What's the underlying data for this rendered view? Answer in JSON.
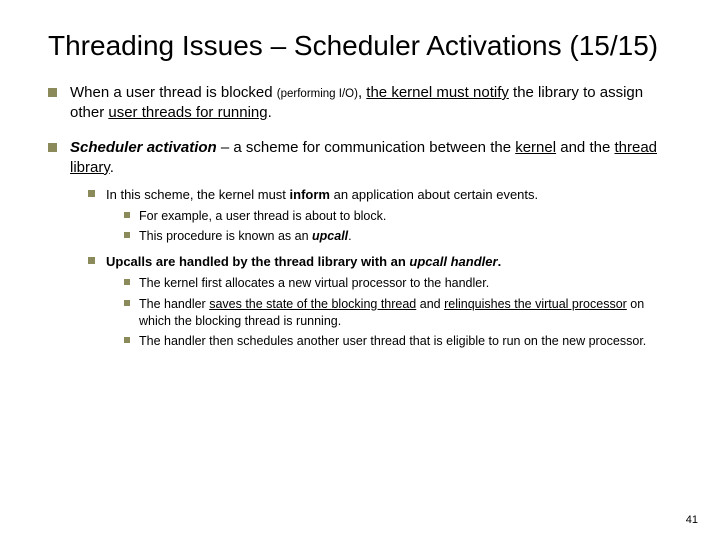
{
  "title": "Threading Issues – Scheduler Activations (15/15)",
  "bullets": {
    "b1_pre": "When a user thread is blocked ",
    "b1_small": "(performing I/O)",
    "b1_mid1": ", ",
    "b1_u1": "the kernel must notify",
    "b1_mid2": " the library to assign other ",
    "b1_u2": "user threads for running",
    "b1_end": ".",
    "b2_term": "Scheduler activation",
    "b2_mid1": " – a scheme for communication between the ",
    "b2_u1": "kernel",
    "b2_mid2": " and the ",
    "b2_u2": "thread library",
    "b2_end": ".",
    "b2a_pre": "In this scheme, the kernel must ",
    "b2a_b": "inform",
    "b2a_post": " an application about certain events.",
    "b2a_i": "For example, a user thread is about to block.",
    "b2a_ii_pre": "This procedure is known as an ",
    "b2a_ii_term": "upcall",
    "b2a_ii_end": ".",
    "b2b_pre": "Upcalls are handled by the thread library with an ",
    "b2b_term": "upcall handler",
    "b2b_end": ".",
    "b2b_i": "The kernel first allocates a new virtual processor to the handler.",
    "b2b_ii_pre": "The handler ",
    "b2b_ii_u1": "saves the state of the blocking thread",
    "b2b_ii_mid": " and ",
    "b2b_ii_u2": "relinquishes the virtual processor",
    "b2b_ii_post": " on which the blocking thread is running.",
    "b2b_iii": "The handler then schedules another user thread that is eligible to run on the new processor."
  },
  "page": "41"
}
